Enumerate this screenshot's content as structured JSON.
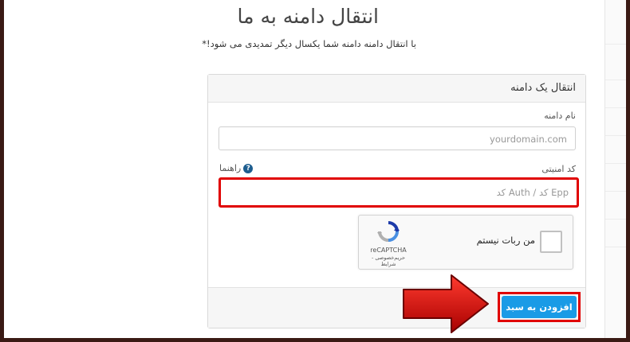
{
  "page": {
    "title": "انتقال دامنه به ما",
    "subtitle": "با انتقال دامنه دامنه شما یکسال دیگر تمدیدی می شود!*"
  },
  "panel": {
    "heading": "انتقال یک دامنه",
    "domain_label": "نام دامنه",
    "domain_placeholder": "yourdomain.com",
    "auth_label": "کد امنیتی",
    "help_label": "راهنما",
    "auth_placeholder": "Epp کد / Auth کد",
    "submit_label": "افزودن به سبد"
  },
  "captcha": {
    "checkbox_label": "من ربات نیستم",
    "brand": "reCAPTCHA",
    "terms": "حریم‌خصوصی - شرایط"
  },
  "colors": {
    "accent": "#1a9be6",
    "highlight": "#e00000",
    "arrow": "#c40000",
    "frame": "#3a1a14"
  },
  "icons": {
    "help": "question-circle-icon",
    "recaptcha": "recaptcha-logo-icon",
    "pointer": "arrow-right-icon"
  }
}
